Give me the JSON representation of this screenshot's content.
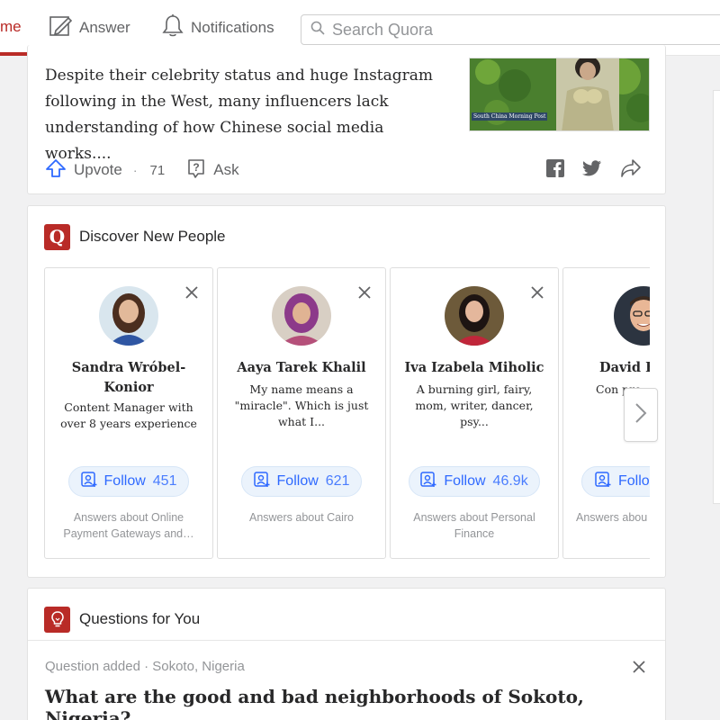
{
  "nav": {
    "home_label": "me",
    "answer_label": "Answer",
    "notifications_label": "Notifications",
    "search_placeholder": "Search Quora"
  },
  "story": {
    "text": "Despite their celebrity status and huge Instagram following in the West, many influencers lack understanding of how Chinese social media works....",
    "image_caption": "South China Morning Post",
    "upvote_label": "Upvote",
    "upvote_count": "71",
    "ask_label": "Ask"
  },
  "discover": {
    "title": "Discover New People",
    "people": [
      {
        "name": "Sandra Wróbel-Konior",
        "bio": "Content Manager with over 8 years experience",
        "follow_label": "Follow",
        "follow_count": "451",
        "topic": "Answers about Online Payment Gateways and…"
      },
      {
        "name": "Aaya Tarek Khalil",
        "bio": "My name means a \"miracle\". Which is just what I...",
        "follow_label": "Follow",
        "follow_count": "621",
        "topic": "Answers about Cairo"
      },
      {
        "name": "Iva Izabela Miholic",
        "bio": "A burning girl, fairy, mom, writer, dancer, psy...",
        "follow_label": "Follow",
        "follow_count": "46.9k",
        "topic": "Answers about Personal Finance"
      },
      {
        "name": "David F",
        "bio": "Con pro",
        "follow_label": "Follo",
        "follow_count": "",
        "topic": "Answers abou"
      }
    ]
  },
  "questions": {
    "title": "Questions for You",
    "meta": "Question added · Sokoto, Nigeria",
    "question": "What are the good and bad neighborhoods of Sokoto, Nigeria?"
  },
  "colors": {
    "brand": "#b92b27",
    "follow_blue": "#2e69ff",
    "muted": "#939598"
  }
}
